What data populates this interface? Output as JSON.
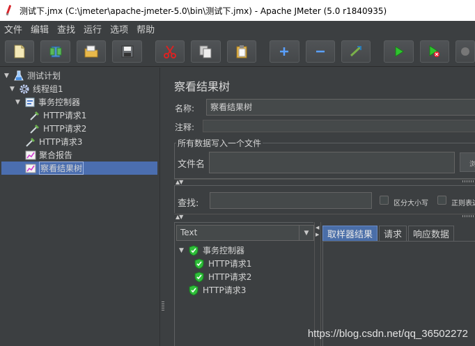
{
  "window": {
    "title": "测试下.jmx (C:\\jmeter\\apache-jmeter-5.0\\bin\\测试下.jmx) - Apache JMeter (5.0 r1840935)"
  },
  "menu": [
    "文件",
    "编辑",
    "查找",
    "运行",
    "选项",
    "帮助"
  ],
  "toolbar": {
    "buttons": [
      "new-icon",
      "templates-icon",
      "open-icon",
      "save-icon",
      "cut-icon",
      "copy-icon",
      "paste-icon",
      "expand-icon",
      "collapse-icon",
      "toggle-icon",
      "start-icon",
      "start-no-pause-icon",
      "stop-icon"
    ]
  },
  "tree": {
    "items": [
      {
        "label": "测试计划",
        "icon": "test-plan-icon",
        "level": 0,
        "expanded": true
      },
      {
        "label": "线程组1",
        "icon": "gear-icon",
        "level": 1,
        "expanded": true
      },
      {
        "label": "事务控制器",
        "icon": "transaction-controller-icon",
        "level": 2,
        "expanded": true
      },
      {
        "label": "HTTP请求1",
        "icon": "pipette-icon",
        "level": 3
      },
      {
        "label": "HTTP请求2",
        "icon": "pipette-icon",
        "level": 3
      },
      {
        "label": "HTTP请求3",
        "icon": "pipette-icon",
        "level": 2
      },
      {
        "label": "聚合报告",
        "icon": "listener-chart-icon",
        "level": 2
      },
      {
        "label": "察看结果树",
        "icon": "listener-chart-icon",
        "level": 2,
        "selected": true
      }
    ]
  },
  "panel": {
    "title": "察看结果树",
    "name_label": "名称:",
    "name_value": "察看结果树",
    "comment_label": "注释:",
    "file_group_title": "所有数据写入一个文件",
    "filename_label": "文件名",
    "browse_label": "浏",
    "search_label": "查找:",
    "case_sensitive_label": "区分大小写",
    "regex_label": "正则表达"
  },
  "results": {
    "renderer": "Text",
    "items": [
      {
        "label": "事务控制器",
        "status": "success"
      },
      {
        "label": "HTTP请求1",
        "status": "success"
      },
      {
        "label": "HTTP请求2",
        "status": "success"
      },
      {
        "label": "HTTP请求3",
        "status": "success"
      }
    ],
    "tabs": [
      "取样器结果",
      "请求",
      "响应数据"
    ],
    "active_tab": "取样器结果"
  },
  "watermark": "https://blog.csdn.net/qq_36502272"
}
